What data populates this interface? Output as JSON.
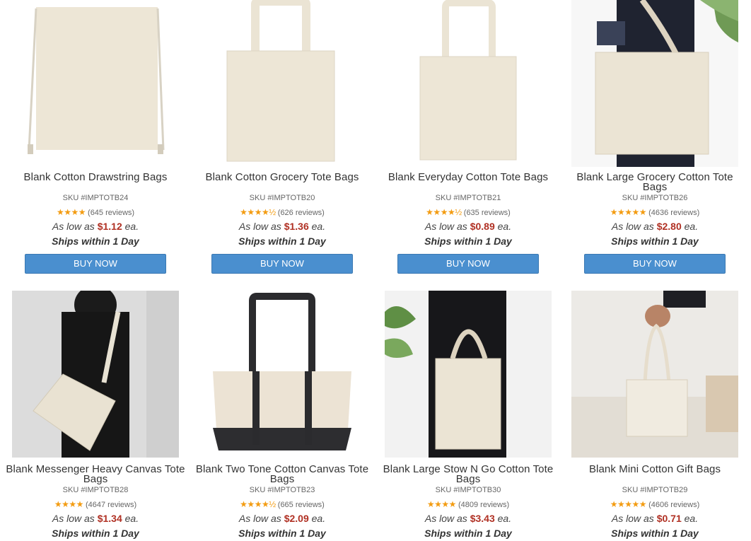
{
  "products": [
    {
      "title": "Blank Cotton Drawstring Bags",
      "sku": "SKU #IMPTOTB24",
      "stars": "★★★★",
      "reviews": "(645 reviews)",
      "price_prefix": "As low as",
      "price": "$1.12",
      "price_suffix": "ea.",
      "ships": "Ships within 1 Day",
      "button": "BUY NOW",
      "image_icon": "drawstring-bag-icon"
    },
    {
      "title": "Blank Cotton Grocery Tote Bags",
      "sku": "SKU #IMPTOTB20",
      "stars": "★★★★½",
      "reviews": "(626 reviews)",
      "price_prefix": "As low as",
      "price": "$1.36",
      "price_suffix": "ea.",
      "ships": "Ships within 1 Day",
      "button": "BUY NOW",
      "image_icon": "grocery-tote-icon"
    },
    {
      "title": "Blank Everyday Cotton Tote Bags",
      "sku": "SKU #IMPTOTB21",
      "stars": "★★★★½",
      "reviews": "(635 reviews)",
      "price_prefix": "As low as",
      "price": "$0.89",
      "price_suffix": "ea.",
      "ships": "Ships within 1 Day",
      "button": "BUY NOW",
      "image_icon": "everyday-tote-icon"
    },
    {
      "title": "Blank Large Grocery Cotton Tote Bags",
      "sku": "SKU #IMPTOTB26",
      "stars": "★★★★★",
      "reviews": "(4636 reviews)",
      "price_prefix": "As low as",
      "price": "$2.80",
      "price_suffix": "ea.",
      "ships": "Ships within 1 Day",
      "button": "BUY NOW",
      "image_icon": "large-grocery-tote-icon"
    },
    {
      "title": "Blank Messenger Heavy Canvas Tote Bags",
      "sku": "SKU #IMPTOTB28",
      "stars": "★★★★",
      "reviews": "(4647 reviews)",
      "price_prefix": "As low as",
      "price": "$1.34",
      "price_suffix": "ea.",
      "ships": "Ships within 1 Day",
      "button": "",
      "image_icon": "messenger-tote-icon"
    },
    {
      "title": "Blank Two Tone Cotton Canvas Tote Bags",
      "sku": "SKU #IMPTOTB23",
      "stars": "★★★★½",
      "reviews": "(665 reviews)",
      "price_prefix": "As low as",
      "price": "$2.09",
      "price_suffix": "ea.",
      "ships": "Ships within 1 Day",
      "button": "",
      "image_icon": "two-tone-tote-icon"
    },
    {
      "title": "Blank Large Stow N Go Cotton Tote Bags",
      "sku": "SKU #IMPTOTB30",
      "stars": "★★★★",
      "reviews": "(4809 reviews)",
      "price_prefix": "As low as",
      "price": "$3.43",
      "price_suffix": "ea.",
      "ships": "Ships within 1 Day",
      "button": "",
      "image_icon": "stow-n-go-tote-icon"
    },
    {
      "title": "Blank Mini Cotton Gift Bags",
      "sku": "SKU #IMPTOTB29",
      "stars": "★★★★★",
      "reviews": "(4606 reviews)",
      "price_prefix": "As low as",
      "price": "$0.71",
      "price_suffix": "ea.",
      "ships": "Ships within 1 Day",
      "button": "",
      "image_icon": "mini-gift-bag-icon"
    }
  ],
  "colors": {
    "price": "#b03023",
    "button": "#4a8fcf",
    "stars": "#f39c12",
    "canvas": "#efe8da"
  }
}
